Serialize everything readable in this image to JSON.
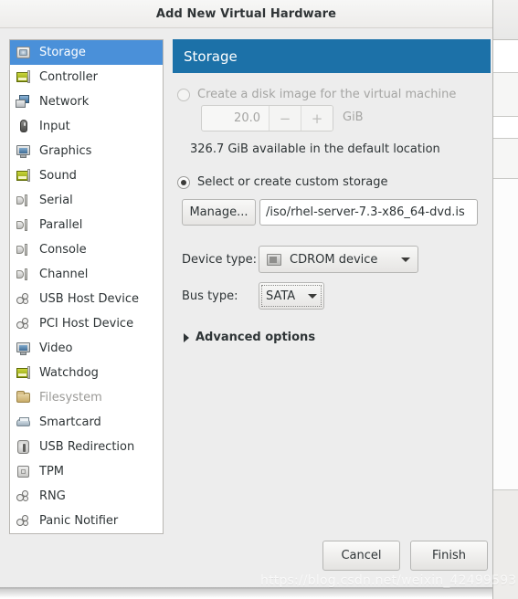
{
  "dialog": {
    "title": "Add New Virtual Hardware"
  },
  "sidebar": {
    "items": [
      {
        "label": "Storage",
        "icon": "disk-icon",
        "selected": true,
        "disabled": false
      },
      {
        "label": "Controller",
        "icon": "card-icon",
        "selected": false,
        "disabled": false
      },
      {
        "label": "Network",
        "icon": "network-icon",
        "selected": false,
        "disabled": false
      },
      {
        "label": "Input",
        "icon": "mouse-icon",
        "selected": false,
        "disabled": false
      },
      {
        "label": "Graphics",
        "icon": "monitor-icon",
        "selected": false,
        "disabled": false
      },
      {
        "label": "Sound",
        "icon": "card-icon",
        "selected": false,
        "disabled": false
      },
      {
        "label": "Serial",
        "icon": "plug-icon",
        "selected": false,
        "disabled": false
      },
      {
        "label": "Parallel",
        "icon": "plug-icon",
        "selected": false,
        "disabled": false
      },
      {
        "label": "Console",
        "icon": "plug-icon",
        "selected": false,
        "disabled": false
      },
      {
        "label": "Channel",
        "icon": "plug-icon",
        "selected": false,
        "disabled": false
      },
      {
        "label": "USB Host Device",
        "icon": "gears-icon",
        "selected": false,
        "disabled": false
      },
      {
        "label": "PCI Host Device",
        "icon": "gears-icon",
        "selected": false,
        "disabled": false
      },
      {
        "label": "Video",
        "icon": "monitor-icon",
        "selected": false,
        "disabled": false
      },
      {
        "label": "Watchdog",
        "icon": "card-icon",
        "selected": false,
        "disabled": false
      },
      {
        "label": "Filesystem",
        "icon": "folder-icon",
        "selected": false,
        "disabled": true
      },
      {
        "label": "Smartcard",
        "icon": "smartcard-icon",
        "selected": false,
        "disabled": false
      },
      {
        "label": "USB Redirection",
        "icon": "usb-icon",
        "selected": false,
        "disabled": false
      },
      {
        "label": "TPM",
        "icon": "chip-icon",
        "selected": false,
        "disabled": false
      },
      {
        "label": "RNG",
        "icon": "gears-icon",
        "selected": false,
        "disabled": false
      },
      {
        "label": "Panic Notifier",
        "icon": "gears-icon",
        "selected": false,
        "disabled": false
      }
    ]
  },
  "panel": {
    "header": "Storage",
    "create_disk": {
      "radio_label": "Create a disk image for the virtual machine",
      "selected": false,
      "enabled": false,
      "size_value": "20.0",
      "minus_label": "−",
      "plus_label": "+",
      "unit": "GiB",
      "available_text": "326.7 GiB available in the default location"
    },
    "custom_storage": {
      "radio_label": "Select or create custom storage",
      "selected": true,
      "manage_label": "Manage...",
      "path_value": "/iso/rhel-server-7.3-x86_64-dvd.is"
    },
    "device_type": {
      "label": "Device type:",
      "value": "CDROM device",
      "icon": "cdrom-icon"
    },
    "bus_type": {
      "label": "Bus type:",
      "value": "SATA",
      "focused": true
    },
    "advanced": {
      "label": "Advanced options",
      "expanded": false
    }
  },
  "footer": {
    "cancel_label": "Cancel",
    "finish_label": "Finish"
  },
  "watermark": {
    "text": "https://blog.csdn.net/weixin_42499593"
  },
  "colors": {
    "header_blue": "#1c71a8",
    "selection_blue": "#4a90d9",
    "dialog_bg": "#ededed",
    "text": "#2e3436",
    "disabled_text": "#a5a5a3"
  }
}
